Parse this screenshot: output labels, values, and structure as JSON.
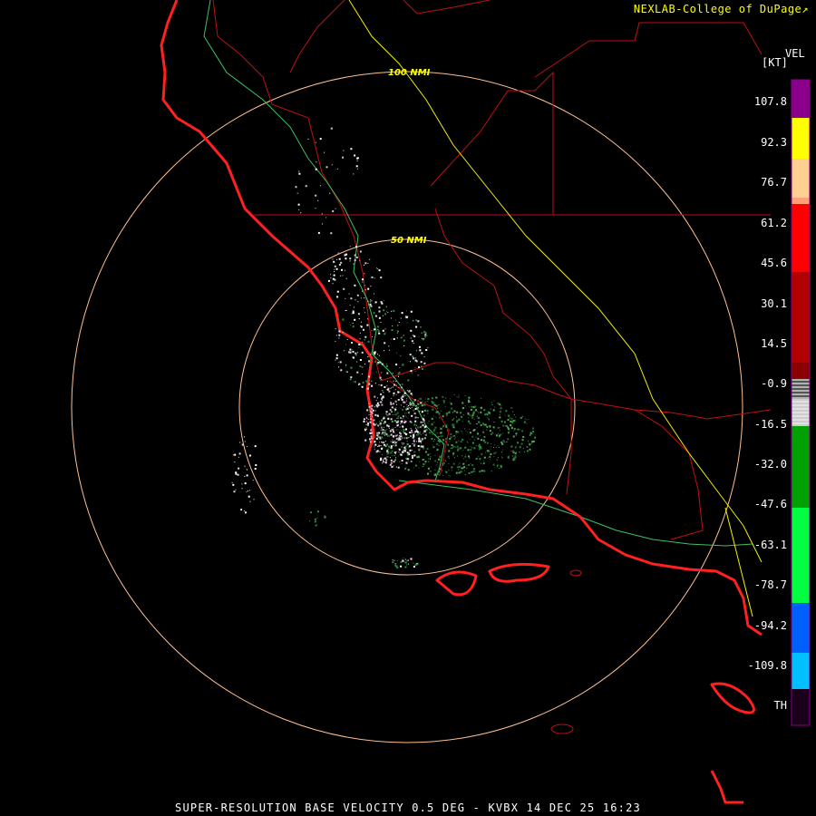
{
  "credit": "NEXLAB-College of DuPage",
  "credit_icon": "external-link-icon",
  "legend": {
    "title": "VEL",
    "units": "[KT]",
    "ticks": [
      "107.8",
      "92.3",
      "76.7",
      "61.2",
      "45.6",
      "30.1",
      "14.5",
      "-0.9",
      "-16.5",
      "-32.0",
      "-47.6",
      "-63.1",
      "-78.7",
      "-94.2",
      "-109.8",
      "TH"
    ],
    "colors": {
      "purple": "#8b008b",
      "yellow": "#ffff00",
      "orange": "#ffa07a",
      "red": "#ff0000",
      "dark_red": "#8b0000",
      "gray": "#cccccc",
      "green": "#00a000",
      "lime": "#00ff40",
      "blue": "#0060ff",
      "cyan": "#00c0ff",
      "th": "#1a001a"
    }
  },
  "rings": [
    {
      "label": "100 NMI"
    },
    {
      "label": "50 NMI"
    }
  ],
  "caption": "SUPER-RESOLUTION BASE VELOCITY 0.5 DEG - KVBX 14 DEC 25 16:23",
  "map_colors": {
    "coastline": "#ff2020",
    "county": "#c01010",
    "highway_green": "#40c060",
    "highway_yellow": "#f0f000",
    "ring": "#ffc090"
  }
}
